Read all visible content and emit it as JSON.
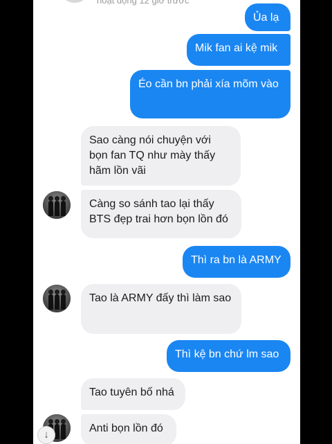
{
  "header": {
    "status_text": "hoạt động 12 giờ trước"
  },
  "messages": [
    {
      "side": "out",
      "text": "Ủa lạ"
    },
    {
      "side": "out",
      "text": "Mik fan ai kệ mik"
    },
    {
      "side": "out",
      "text": "Éo cần bn phải xía mõm vào"
    },
    {
      "side": "in",
      "text": "Sao càng nói chuyện với bọn fan TQ như mày thấy hãm lồn vãi"
    },
    {
      "side": "in",
      "text": "Càng so sánh tao lại thấy BTS đẹp trai hơn bọn lồn đó"
    },
    {
      "side": "out",
      "text": "Thì ra bn là ARMY"
    },
    {
      "side": "in",
      "text": "Tao là ARMY đấy thì làm sao"
    },
    {
      "side": "out",
      "text": "Thì kệ bn chứ lm sao"
    },
    {
      "side": "in",
      "text": "Tao tuyên bố nhá"
    },
    {
      "side": "in",
      "text": "Anti bọn lồn đó"
    }
  ],
  "icons": {
    "scroll_down": "↓"
  },
  "colors": {
    "outgoing_bubble": "#1a86f2",
    "incoming_bubble": "#efeff2",
    "background": "#ffffff"
  }
}
